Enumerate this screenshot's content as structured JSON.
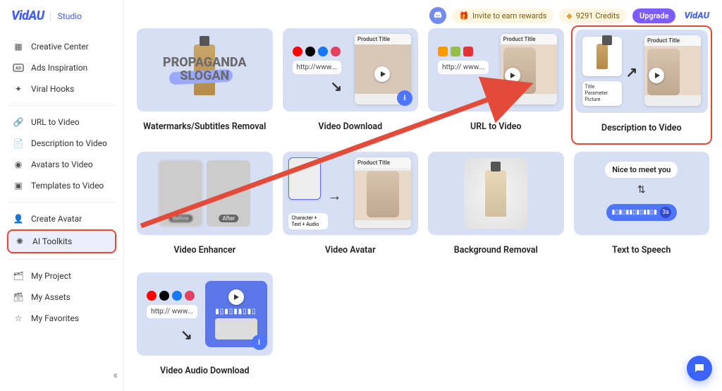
{
  "brand": {
    "logo": "VidAU",
    "sublabel": "Studio"
  },
  "topbar": {
    "invite": "Invite to earn rewards",
    "credits": "9291 Credits",
    "upgrade": "Upgrade",
    "brand_small": "VidAU"
  },
  "sidebar": {
    "groups": [
      [
        {
          "icon": "grid",
          "label": "Creative Center"
        },
        {
          "icon": "ad",
          "label": "Ads Inspiration"
        },
        {
          "icon": "fire",
          "label": "Viral Hooks"
        }
      ],
      [
        {
          "icon": "link",
          "label": "URL to Video"
        },
        {
          "icon": "doc",
          "label": "Description to Video"
        },
        {
          "icon": "avatar",
          "label": "Avatars to Video"
        },
        {
          "icon": "template",
          "label": "Templates to Video"
        }
      ],
      [
        {
          "icon": "person",
          "label": "Create Avatar"
        },
        {
          "icon": "spark",
          "label": "AI Toolkits",
          "active": true
        }
      ],
      [
        {
          "icon": "folder",
          "label": "My Project"
        },
        {
          "icon": "box",
          "label": "My Assets"
        },
        {
          "icon": "star",
          "label": "My Favorites"
        }
      ]
    ]
  },
  "tools": [
    {
      "id": "watermarks",
      "title": "Watermarks/Subtitles Removal",
      "thumb": {
        "headline": "PROPAGANDA",
        "sub": "SLOGAN"
      }
    },
    {
      "id": "download",
      "title": "Video Download",
      "thumb": {
        "url": "http://www...",
        "panel_title": "Product Title"
      }
    },
    {
      "id": "url2video",
      "title": "URL to Video",
      "thumb": {
        "url": "http:// www...",
        "panel_title": "Product Title"
      }
    },
    {
      "id": "desc2video",
      "title": "Description to Video",
      "highlight": true,
      "thumb": {
        "lines": [
          "Title",
          "Parameter",
          "Picture"
        ],
        "panel_title": "Product Title"
      }
    },
    {
      "id": "enhancer",
      "title": "Video Enhancer",
      "thumb": {
        "before": "Before",
        "after": "After"
      }
    },
    {
      "id": "avatar",
      "title": "Video Avatar",
      "thumb": {
        "panel_title": "Product Title",
        "char": "Character + Text + Audio"
      }
    },
    {
      "id": "bgremove",
      "title": "Background Removal"
    },
    {
      "id": "tts",
      "title": "Text to Speech",
      "thumb": {
        "bubble": "Nice to meet you",
        "dur": "3s"
      }
    },
    {
      "id": "audio",
      "title": "Video Audio Download",
      "thumb": {
        "url": "http:// www..."
      }
    }
  ],
  "colors": {
    "accent": "#425DF5",
    "highlight": "#E44A3A"
  }
}
